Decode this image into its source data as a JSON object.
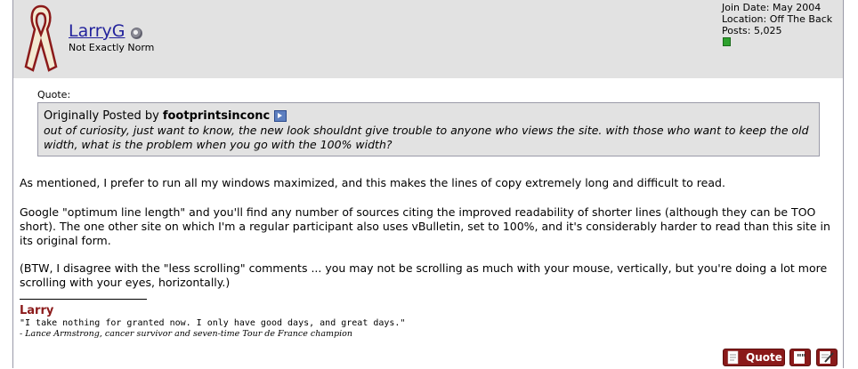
{
  "user": {
    "name": "LarryG",
    "title": "Not Exactly Norm",
    "join_date": "Join Date: May 2004",
    "location": "Location: Off The Back",
    "posts": "Posts: 5,025"
  },
  "quote": {
    "label": "Quote:",
    "originally_posted_by": "Originally Posted by",
    "author": "footprintsinconc",
    "text": "out of curiosity, just want to know, the new look shouldnt give trouble to anyone who views the site. with those who want to keep the old width, what is the problem when you go with the 100% width?"
  },
  "post": {
    "paragraphs": [
      "As mentioned, I prefer to run all my windows maximized, and this makes the lines of copy extremely long and difficult to read.",
      "Google \"optimum line length\" and you'll find any number of sources citing the improved readability of shorter lines (although they can be TOO short). The one other site on which I'm a regular participant also uses vBulletin, set to 100%, and it's considerably harder to read than this site in its original form.",
      "(BTW, I disagree with the \"less scrolling\" comments ... you may not be scrolling as much with your mouse, vertically, but you're doing a lot more scrolling with your eyes, horizontally.)"
    ]
  },
  "signature": {
    "name": "Larry",
    "quote": "\"I take nothing for granted now. I only have good days, and great days.\"",
    "attribution": "- Lance Armstrong, cancer survivor and seven-time Tour de France champion"
  },
  "buttons": {
    "quote_label": "Quote"
  },
  "icons": {
    "ribbon": "cancer-ribbon-icon",
    "online_status": "offline-status-icon",
    "view_post": "view-post-icon",
    "reputation": "reputation-icon",
    "multi_quote": "multi-quote-icon",
    "edit": "edit-post-icon"
  },
  "colors": {
    "username": "#22229c",
    "userbar_bg": "#e2e2e2",
    "quote_bg": "#e2e2e2",
    "signature_name": "#8b1a1a",
    "button": "#8a1a1a",
    "reputation": "#2ea12e"
  }
}
